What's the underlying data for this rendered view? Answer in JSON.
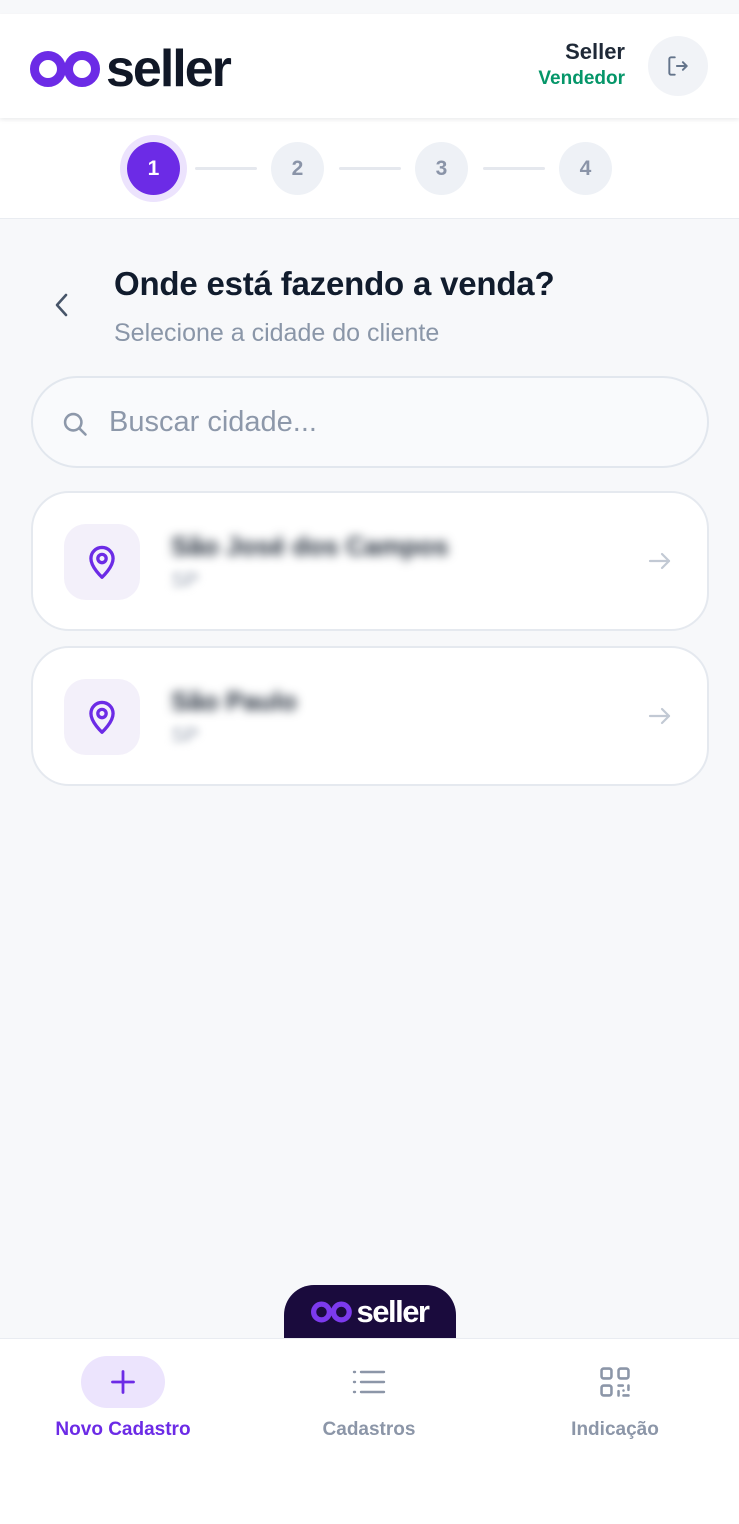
{
  "colors": {
    "accent": "#6c2be6",
    "accent_soft": "#ece4fd",
    "role_green": "#059669",
    "brand_dark": "#1a0b3d"
  },
  "header": {
    "logo_text": "seller",
    "user_name": "Seller",
    "user_role": "Vendedor",
    "logout_icon": "logout-icon"
  },
  "stepper": {
    "current": 1,
    "steps": [
      "1",
      "2",
      "3",
      "4"
    ]
  },
  "page": {
    "back_icon": "chevron-left-icon",
    "title": "Onde está fazendo a venda?",
    "subtitle": "Selecione a cidade do cliente"
  },
  "search": {
    "placeholder": "Buscar cidade...",
    "value": "",
    "icon": "search-icon"
  },
  "cities": [
    {
      "name": "São José dos Campos",
      "state": "SP",
      "icon": "map-pin-icon"
    },
    {
      "name": "São Paulo",
      "state": "SP",
      "icon": "map-pin-icon"
    }
  ],
  "brand_tab": {
    "text": "seller"
  },
  "bottom_nav": {
    "items": [
      {
        "label": "Novo Cadastro",
        "icon": "plus-icon",
        "active": true
      },
      {
        "label": "Cadastros",
        "icon": "list-icon",
        "active": false
      },
      {
        "label": "Indicação",
        "icon": "qr-code-icon",
        "active": false
      }
    ]
  }
}
